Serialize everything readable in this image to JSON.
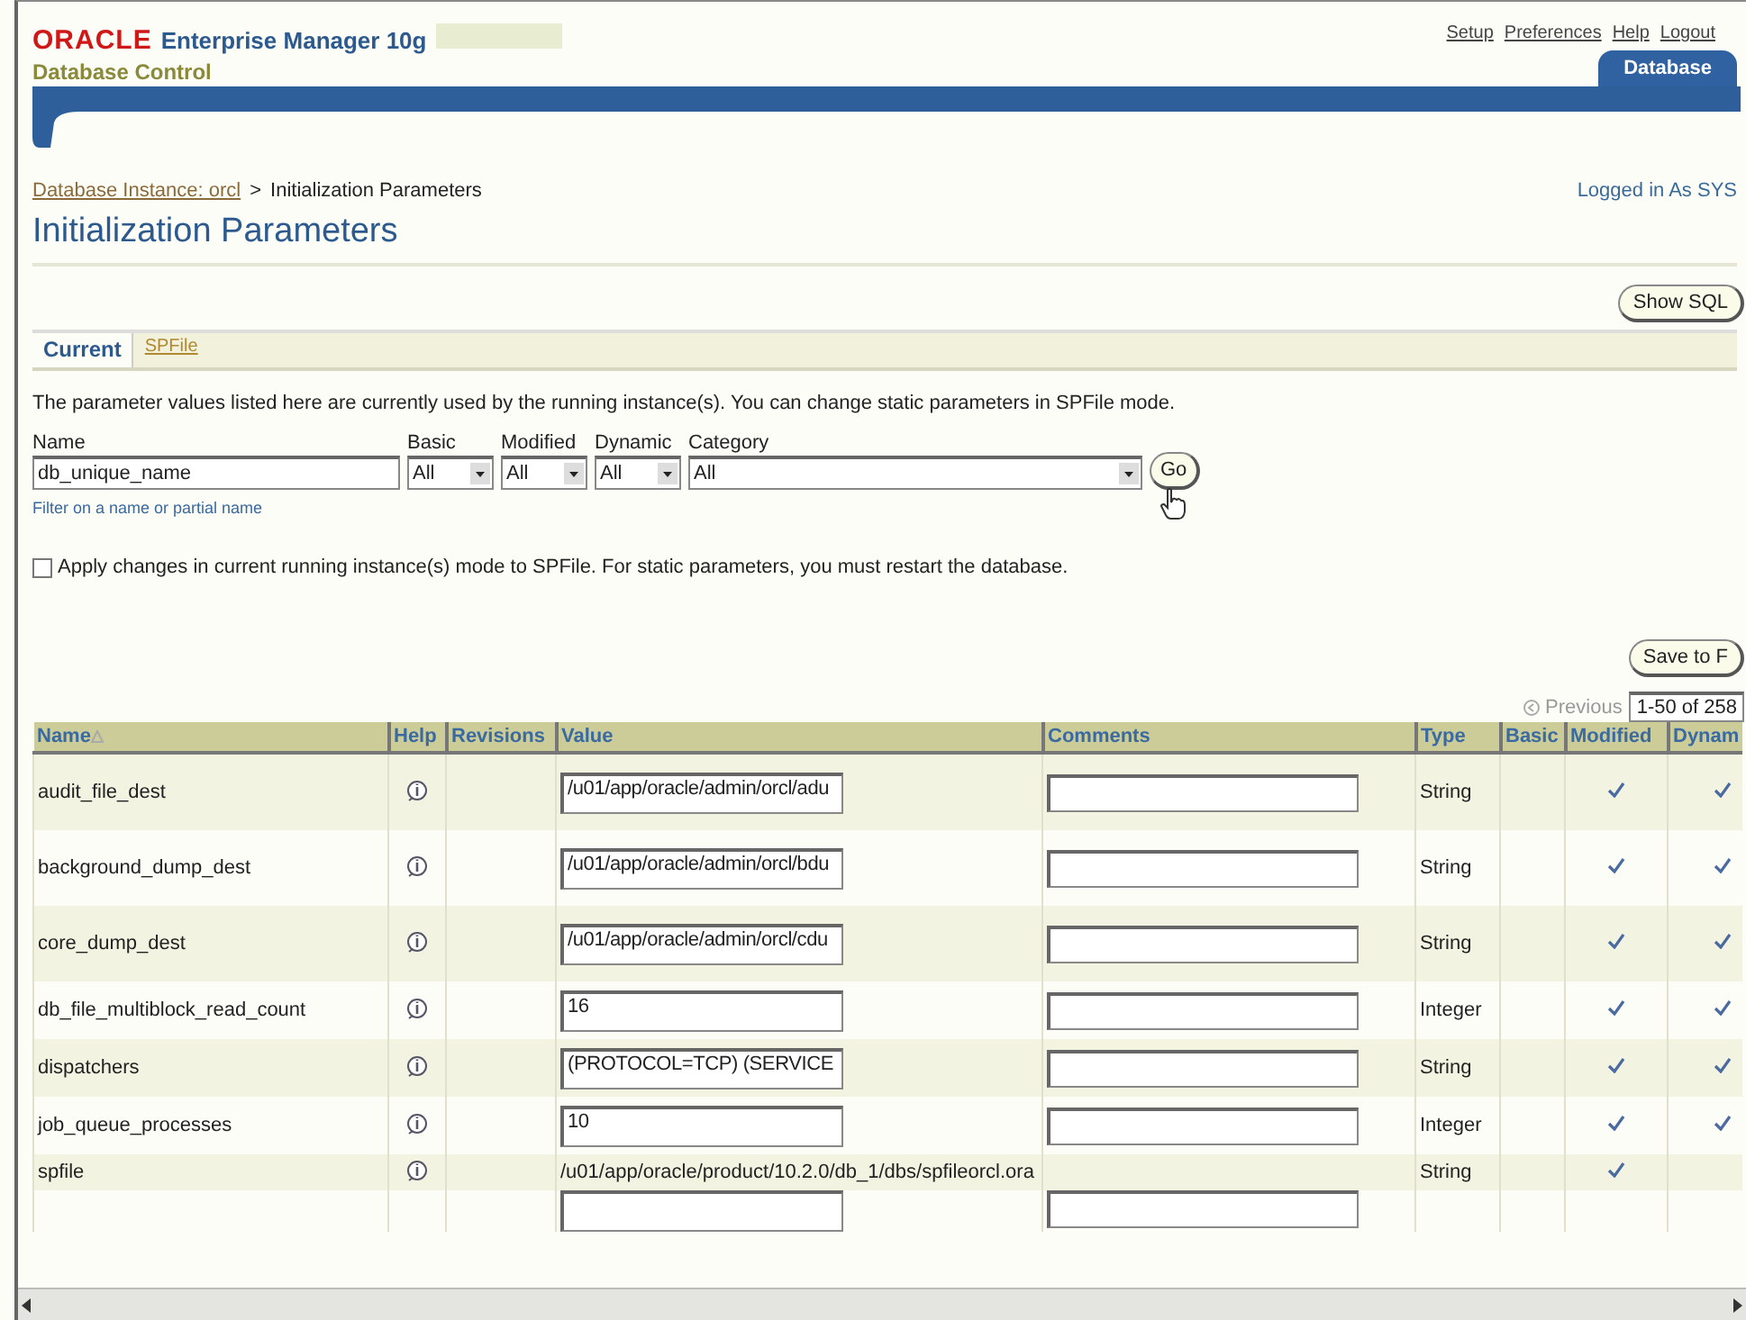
{
  "header": {
    "logo": "ORACLE",
    "product": "Enterprise Manager 10g",
    "subtitle": "Database Control",
    "links": [
      "Setup",
      "Preferences",
      "Help",
      "Logout"
    ],
    "tab": {
      "label": "Database",
      "selected": true
    }
  },
  "breadcrumb": {
    "link": "Database Instance: orcl",
    "separator": ">",
    "current": "Initialization Parameters"
  },
  "logged_in": "Logged in As SYS",
  "title": "Initialization Parameters",
  "show_sql_button": "Show SQL",
  "subtabs": [
    {
      "label": "Current",
      "selected": true
    },
    {
      "label": "SPFile",
      "selected": false
    }
  ],
  "description": "The parameter values listed here are currently used by the running instance(s).  You can change static parameters in SPFile mode.",
  "filter": {
    "name_label": "Name",
    "name_value": "db_unique_name",
    "hint": "Filter on a name or partial name",
    "selects": [
      {
        "label": "Basic",
        "value": "All"
      },
      {
        "label": "Modified",
        "value": "All"
      },
      {
        "label": "Dynamic",
        "value": "All"
      },
      {
        "label": "Category",
        "value": "All"
      }
    ],
    "go_button": "Go"
  },
  "apply_checkbox": {
    "checked": false,
    "label": "Apply changes in current running instance(s) mode to SPFile. For static parameters, you must restart the database."
  },
  "save_button": "Save to F",
  "pagination": {
    "previous": "Previous",
    "previous_disabled": true,
    "range": "1-50 of 258"
  },
  "table": {
    "columns": [
      "Name",
      "Help",
      "Revisions",
      "Value",
      "Comments",
      "Type",
      "Basic",
      "Modified",
      "Dynam"
    ],
    "rows": [
      {
        "name": "audit_file_dest",
        "kind": "field",
        "value": "/u01/app/oracle/admin/orcl/adu",
        "type": "String",
        "basic": false,
        "modified": true,
        "dynamic": true
      },
      {
        "name": "background_dump_dest",
        "kind": "field",
        "value": "/u01/app/oracle/admin/orcl/bdu",
        "type": "String",
        "basic": false,
        "modified": true,
        "dynamic": true
      },
      {
        "name": "core_dump_dest",
        "kind": "field",
        "value": "/u01/app/oracle/admin/orcl/cdu",
        "type": "String",
        "basic": false,
        "modified": true,
        "dynamic": true
      },
      {
        "name": "db_file_multiblock_read_count",
        "kind": "field",
        "value": "16",
        "type": "Integer",
        "basic": false,
        "modified": true,
        "dynamic": true
      },
      {
        "name": "dispatchers",
        "kind": "field",
        "value": "(PROTOCOL=TCP) (SERVICE",
        "type": "String",
        "basic": false,
        "modified": true,
        "dynamic": true
      },
      {
        "name": "job_queue_processes",
        "kind": "field",
        "value": "10",
        "type": "Integer",
        "basic": false,
        "modified": true,
        "dynamic": true
      },
      {
        "name": "spfile",
        "kind": "text",
        "value": "/u01/app/oracle/product/10.2.0/db_1/dbs/spfileorcl.ora",
        "type": "String",
        "basic": false,
        "modified": true,
        "dynamic": false
      }
    ]
  }
}
